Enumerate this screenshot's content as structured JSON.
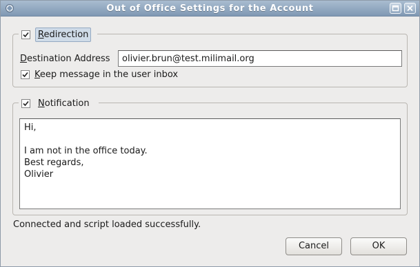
{
  "window": {
    "title": "Out of Office Settings for the Account",
    "icon": "app-icon",
    "controls": [
      "maximize-icon",
      "close-icon"
    ]
  },
  "redirection": {
    "legend_prefix": "",
    "legend_mnemonic": "R",
    "legend_rest": "edirection",
    "checked": true,
    "destination_label_mnemonic": "D",
    "destination_label_rest": "estination Address",
    "destination_value": "olivier.brun@test.milimail.org",
    "keep_mnemonic": "K",
    "keep_rest": "eep message in the user inbox",
    "keep_checked": true
  },
  "notification": {
    "legend_mnemonic": "N",
    "legend_rest": "otification",
    "checked": true,
    "message": "Hi,\n\nI am not in the office today.\nBest regards,\nOlivier"
  },
  "status_text": "Connected and script loaded successfully.",
  "buttons": {
    "cancel": "Cancel",
    "ok": "OK"
  }
}
